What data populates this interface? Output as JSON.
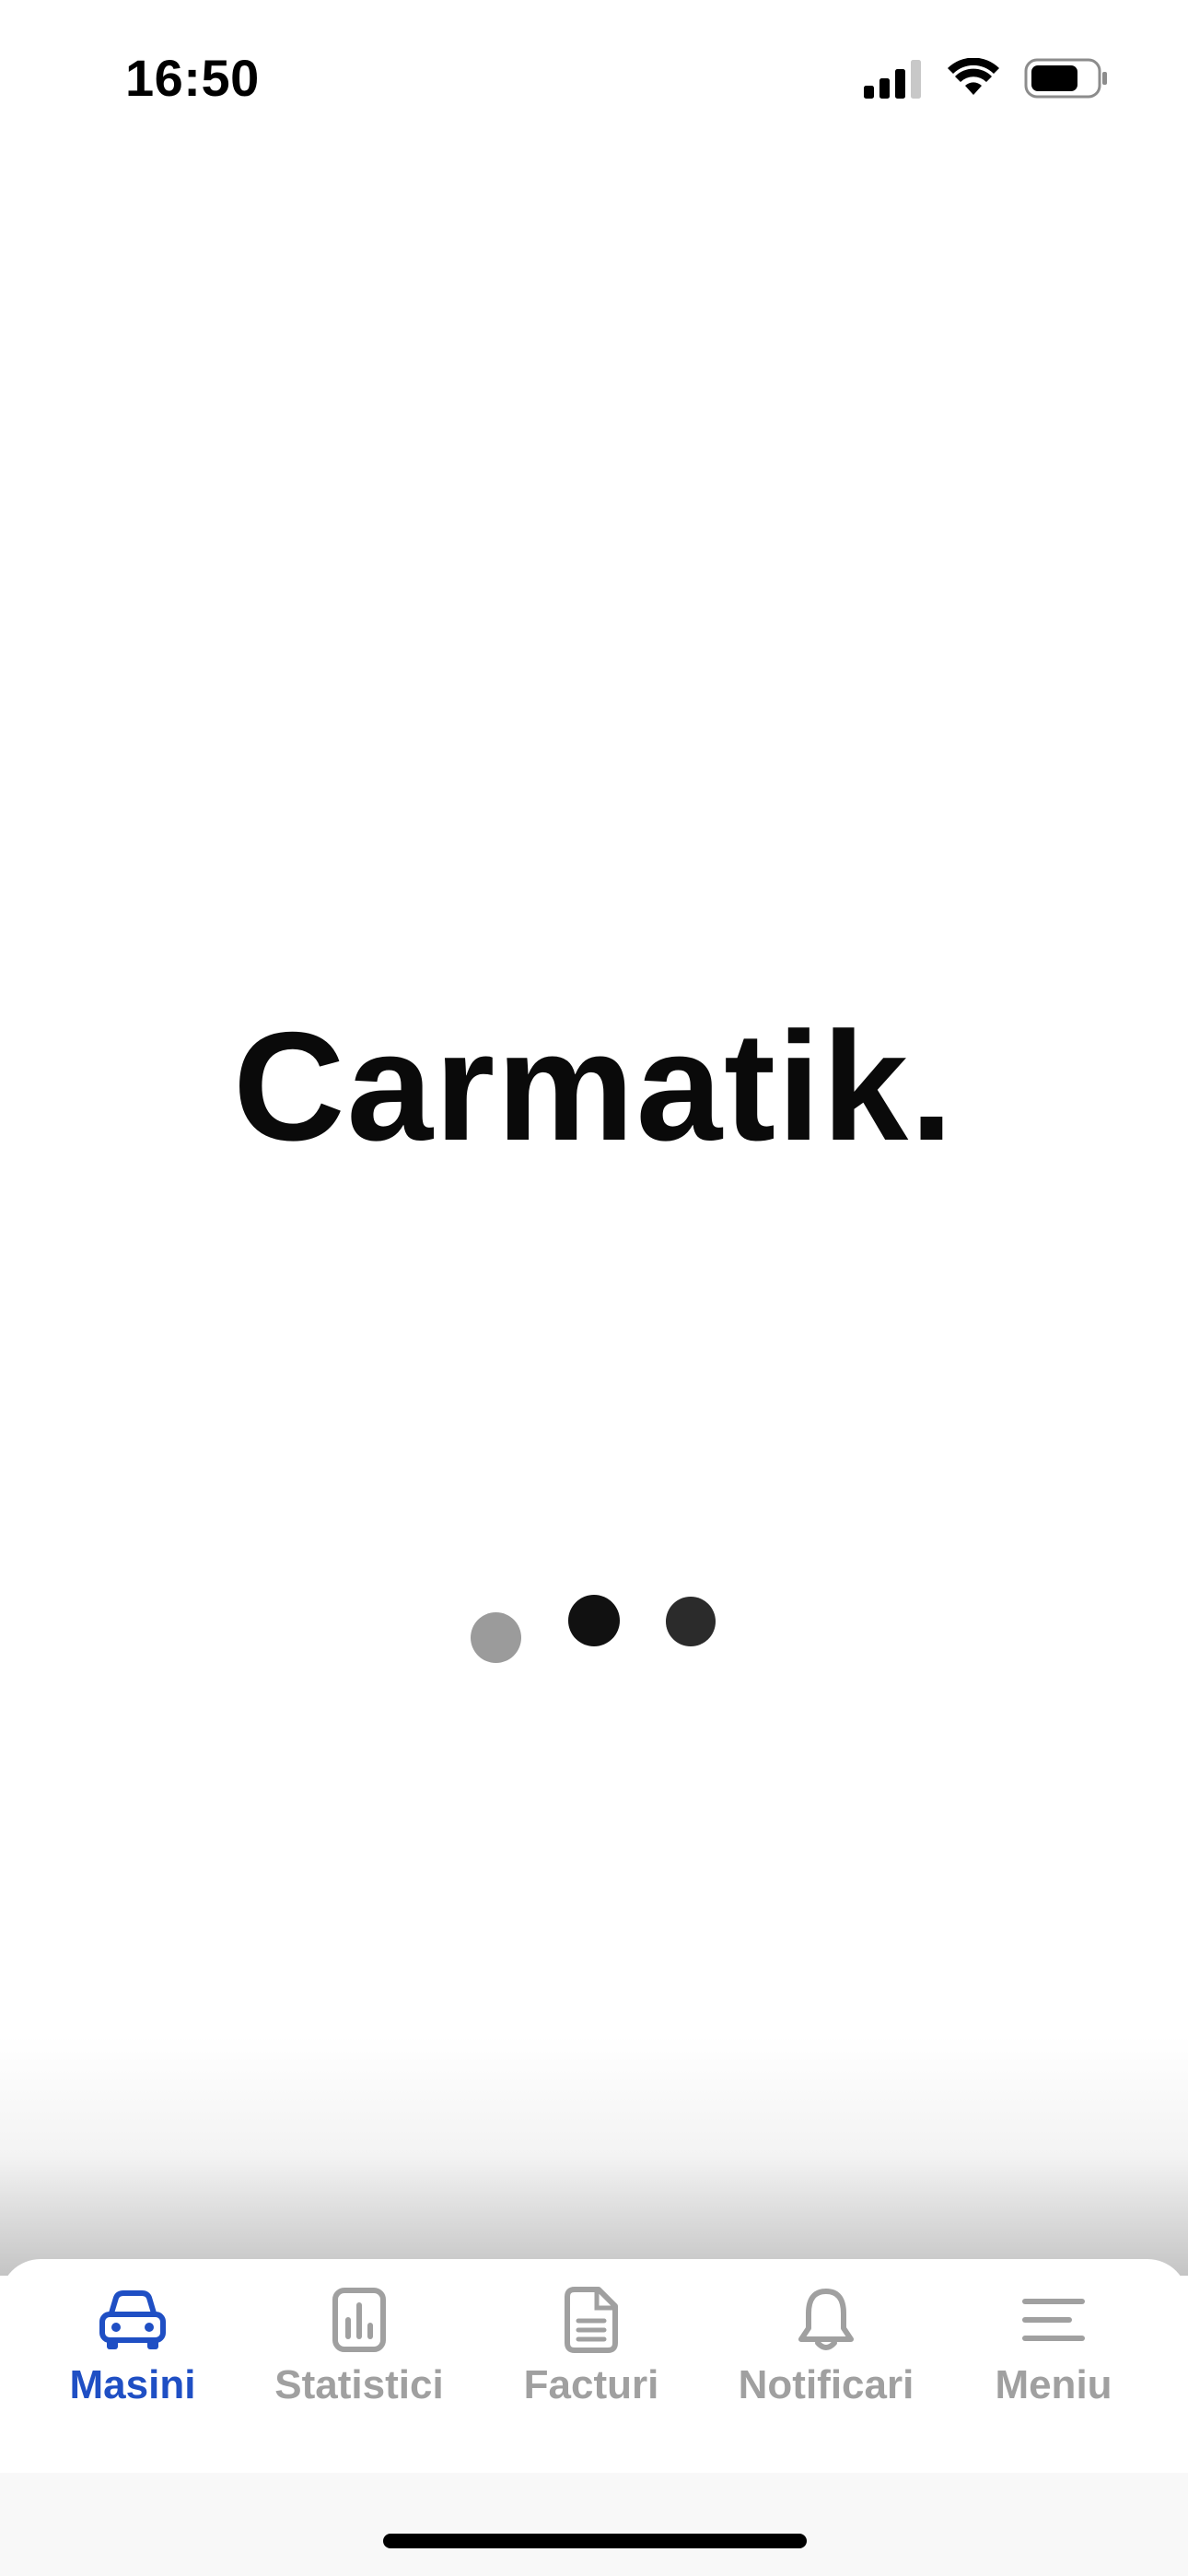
{
  "status_bar": {
    "time": "16:50",
    "icons": [
      "cellular-signal-icon",
      "wifi-icon",
      "battery-icon"
    ]
  },
  "brand": {
    "name": "Carmatik."
  },
  "loading": {
    "dot_colors": [
      "#9b9b9b",
      "#111111",
      "#2b2b2b"
    ]
  },
  "tab_bar": {
    "active_color": "#1f4fc4",
    "inactive_color": "#a0a0a0",
    "tabs": [
      {
        "label": "Masini",
        "icon": "car-icon",
        "active": true
      },
      {
        "label": "Statistici",
        "icon": "bar-chart-icon",
        "active": false
      },
      {
        "label": "Facturi",
        "icon": "document-icon",
        "active": false
      },
      {
        "label": "Notificari",
        "icon": "bell-icon",
        "active": false
      },
      {
        "label": "Meniu",
        "icon": "menu-icon",
        "active": false
      }
    ]
  }
}
